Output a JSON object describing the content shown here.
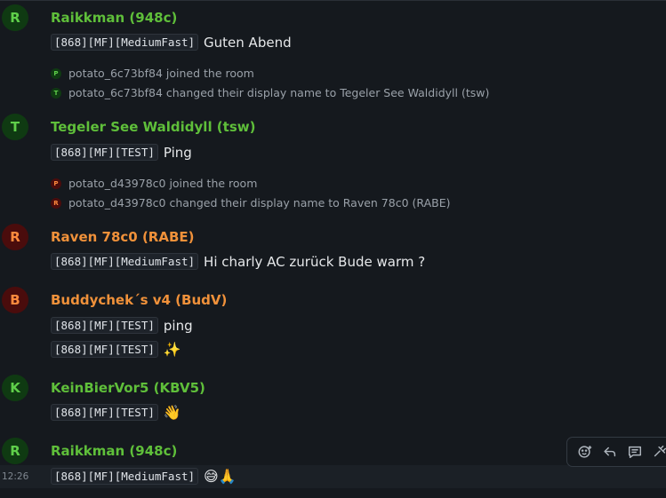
{
  "timeline": {
    "groups": [
      {
        "avatar_letter": "R",
        "sender": "Raikkman (948c)",
        "messages": [
          {
            "tag": "[868][MF][MediumFast]",
            "text": "Guten Abend"
          }
        ],
        "events": [
          {
            "letter": "P",
            "text": "potato_6c73bf84 joined the room"
          },
          {
            "letter": "T",
            "text": "potato_6c73bf84 changed their display name to Tegeler See Waldidyll (tsw)"
          }
        ]
      },
      {
        "avatar_letter": "T",
        "sender": "Tegeler See Waldidyll (tsw)",
        "messages": [
          {
            "tag": "[868][MF][TEST]",
            "text": "Ping"
          }
        ],
        "events": [
          {
            "letter": "P",
            "text": "potato_d43978c0 joined the room"
          },
          {
            "letter": "R",
            "text": "potato_d43978c0 changed their display name to Raven 78c0 (RABE)"
          }
        ]
      },
      {
        "avatar_letter": "R",
        "sender": "Raven 78c0 (RABE)",
        "messages": [
          {
            "tag": "[868][MF][MediumFast]",
            "text": "Hi charly AC zurück Bude warm ?"
          }
        ]
      },
      {
        "avatar_letter": "B",
        "sender": "Buddychek´s v4 (BudV)",
        "messages": [
          {
            "tag": "[868][MF][TEST]",
            "text": "ping"
          },
          {
            "tag": "[868][MF][TEST]",
            "text": "✨"
          }
        ]
      },
      {
        "avatar_letter": "K",
        "sender": "KeinBierVor5 (KBV5)",
        "messages": [
          {
            "tag": "[868][MF][TEST]",
            "text": "👋"
          }
        ]
      },
      {
        "avatar_letter": "R",
        "sender": "Raikkman (948c)",
        "messages": [
          {
            "tag": "[868][MF][MediumFast]",
            "text": "😅🙏"
          }
        ],
        "timestamp": "12:26"
      }
    ]
  },
  "toolbar": {
    "icons": [
      "add-reaction-icon",
      "reply-icon",
      "thread-icon",
      "options-icon"
    ]
  },
  "colors": {
    "background": "#15191e",
    "green_sender": "#5fbf3a",
    "orange_sender": "#f0913a",
    "event_text": "#9aa1a9"
  }
}
